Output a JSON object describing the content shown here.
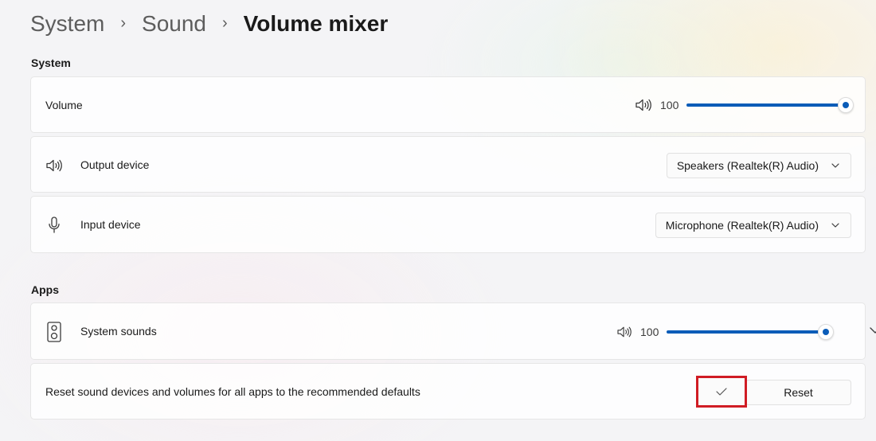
{
  "breadcrumb": {
    "items": [
      "System",
      "Sound"
    ],
    "current": "Volume mixer"
  },
  "system_section": {
    "title": "System",
    "volume": {
      "label": "Volume",
      "value_text": "100",
      "level_percent": 100,
      "icon": "speaker-icon"
    },
    "output": {
      "label": "Output device",
      "selected": "Speakers (Realtek(R) Audio)",
      "icon": "speaker-icon"
    },
    "input": {
      "label": "Input device",
      "selected": "Microphone (Realtek(R) Audio)",
      "icon": "microphone-icon"
    }
  },
  "apps_section": {
    "title": "Apps",
    "system_sounds": {
      "label": "System sounds",
      "value_text": "100",
      "level_percent": 100,
      "icon": "system-sounds-icon"
    },
    "reset": {
      "label": "Reset sound devices and volumes for all apps to the recommended defaults",
      "button_label": "Reset"
    }
  },
  "colors": {
    "accent": "#0a5cb8",
    "highlight": "#d01c24"
  }
}
